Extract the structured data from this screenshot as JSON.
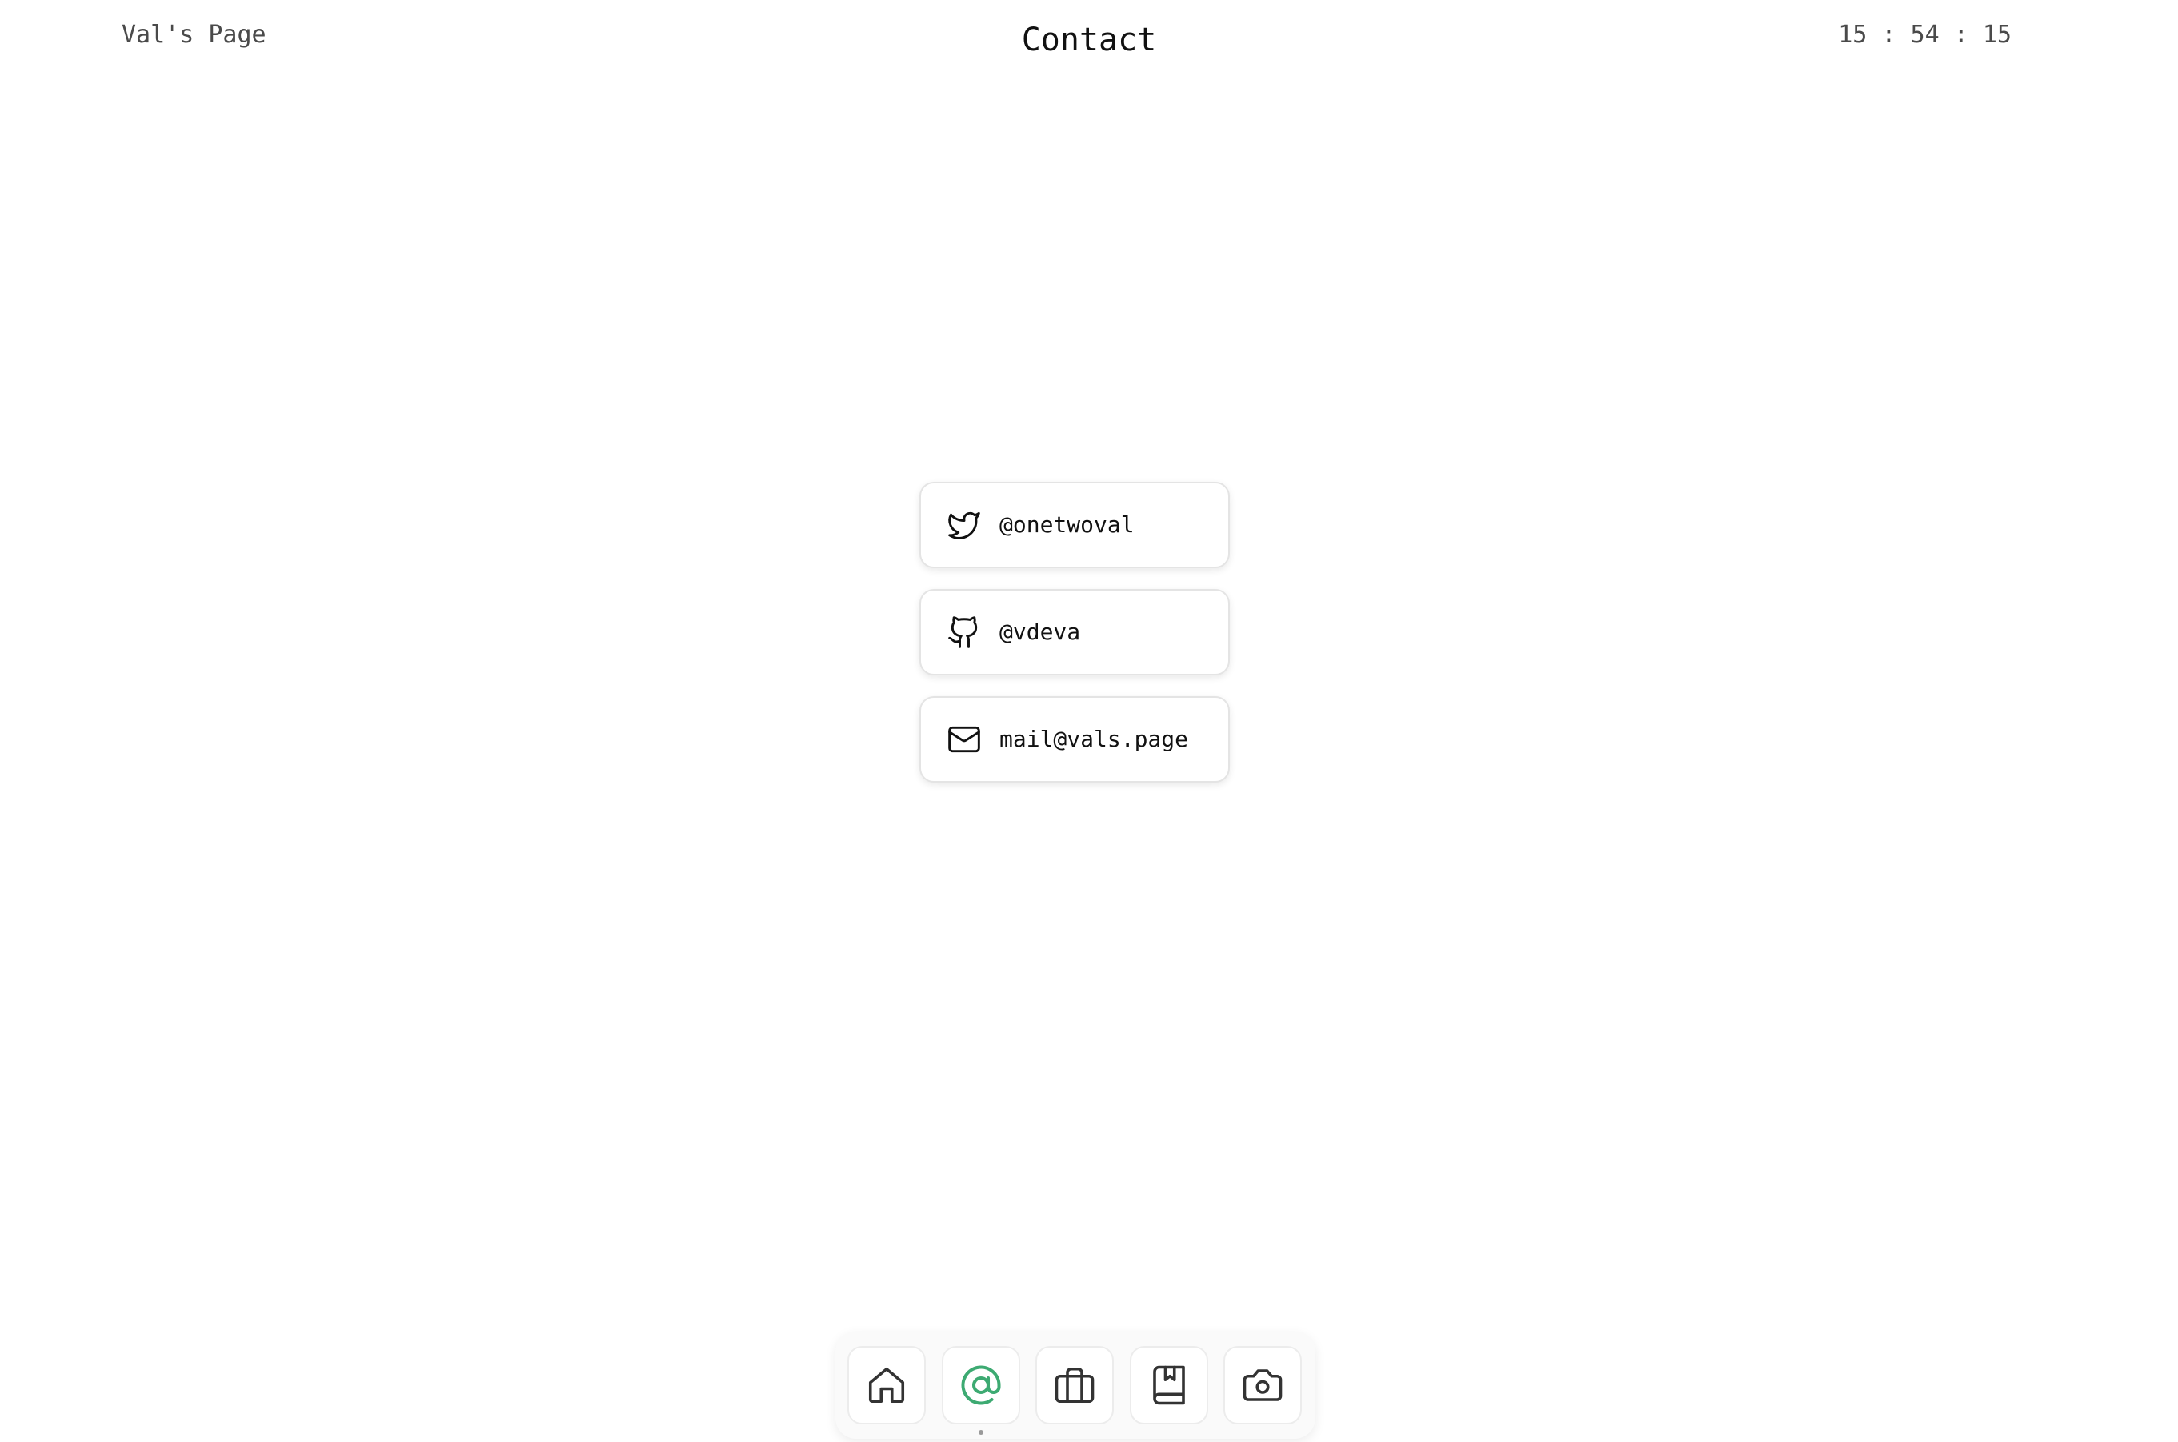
{
  "header": {
    "site_name": "Val's Page",
    "title": "Contact",
    "clock": "15 : 54 : 15"
  },
  "contacts": [
    {
      "icon": "twitter-icon",
      "label": "@onetwoval"
    },
    {
      "icon": "github-icon",
      "label": "@vdeva"
    },
    {
      "icon": "mail-icon",
      "label": "mail@vals.page"
    }
  ],
  "dock": {
    "items": [
      {
        "icon": "home-icon",
        "active": false
      },
      {
        "icon": "at-sign-icon",
        "active": true
      },
      {
        "icon": "briefcase-icon",
        "active": false
      },
      {
        "icon": "book-icon",
        "active": false
      },
      {
        "icon": "camera-icon",
        "active": false
      }
    ],
    "accent_color": "#3daa72",
    "icon_color": "#333333"
  }
}
